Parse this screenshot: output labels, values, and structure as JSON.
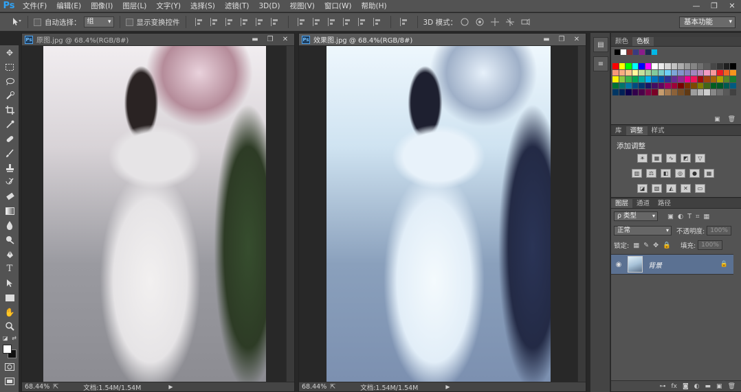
{
  "app": {
    "logo": "Ps"
  },
  "menu": [
    "文件(F)",
    "编辑(E)",
    "图像(I)",
    "图层(L)",
    "文字(Y)",
    "选择(S)",
    "滤镜(T)",
    "3D(D)",
    "视图(V)",
    "窗口(W)",
    "帮助(H)"
  ],
  "window_controls": {
    "minimize": "—",
    "restore": "❐",
    "close": "✕"
  },
  "options": {
    "auto_select_label": "自动选择：",
    "auto_select_value": "组",
    "show_transform_label": "显示变换控件",
    "mode_3d_label": "3D 模式：",
    "workspace": "基本功能"
  },
  "docs": [
    {
      "title": "原图.jpg @ 68.4%(RGB/8#)",
      "zoom": "68.44%",
      "info": "文档:1.54M/1.54M",
      "active": false
    },
    {
      "title": "效果图.jpg @ 68.4%(RGB/8#)",
      "zoom": "68.44%",
      "info": "文档:1.54M/1.54M",
      "active": true
    }
  ],
  "doc_controls": {
    "minimize": "▬",
    "restore": "❐",
    "close": "✕"
  },
  "panels": {
    "swatches_tabs": [
      "颜色",
      "色板"
    ],
    "adjust_tabs": [
      "库",
      "调整",
      "样式"
    ],
    "adjust_title": "添加调整",
    "layers_tabs": [
      "图层",
      "通道",
      "路径"
    ],
    "filter_kind": "ρ 类型",
    "blend_mode": "正常",
    "opacity_label": "不透明度:",
    "opacity_value": "100%",
    "lock_label": "锁定:",
    "fill_label": "填充:",
    "fill_value": "100%",
    "layer_name": "背景"
  },
  "colors": {
    "accent": "#2fa3f6",
    "selected_layer": "#5b7192",
    "ui_panel": "#535353"
  }
}
